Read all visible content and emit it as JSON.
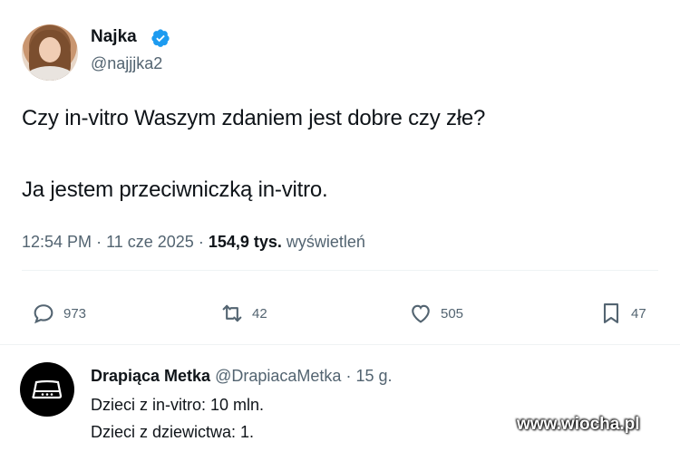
{
  "tweet": {
    "author_name": "Najka",
    "author_handle": "@najjjka2",
    "text_line1": "Czy in-vitro Waszym zdaniem jest dobre czy złe?",
    "text_line2": "Ja jestem przeciwniczką in-vitro.",
    "time": "12:54 PM",
    "date": "11 cze 2025",
    "views_count": "154,9 tys.",
    "views_label": "wyświetleń",
    "verified_color": "#1d9bf0"
  },
  "actions": {
    "replies": "973",
    "retweets": "42",
    "likes": "505",
    "bookmarks": "47"
  },
  "reply": {
    "author_name": "Drapiąca Metka",
    "author_handle": "@DrapiacaMetka",
    "age": "15 g.",
    "line1": "Dzieci z in-vitro: 10 mln.",
    "line2": "Dzieci z dziewictwa: 1."
  },
  "watermark": "www.wiocha.pl"
}
